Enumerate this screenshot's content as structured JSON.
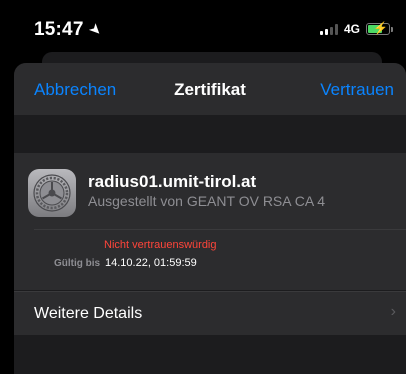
{
  "status_bar": {
    "time": "15:47",
    "network": "4G",
    "location_icon": "location-arrow-icon",
    "battery_color": "#4cd964"
  },
  "nav": {
    "cancel_label": "Abbrechen",
    "title": "Zertifikat",
    "trust_label": "Vertrauen",
    "accent_color": "#0a84ff"
  },
  "certificate": {
    "icon": "gear-icon",
    "name": "radius01.umit-tirol.at",
    "issuer": "Ausgestellt von GEANT OV RSA CA 4",
    "status": "Nicht vertrauenswürdig",
    "status_color": "#ff453a",
    "valid_until_label": "Gültig bis",
    "valid_until_value": "14.10.22, 01:59:59"
  },
  "details": {
    "label": "Weitere Details",
    "chevron_icon": "chevron-right-icon"
  }
}
